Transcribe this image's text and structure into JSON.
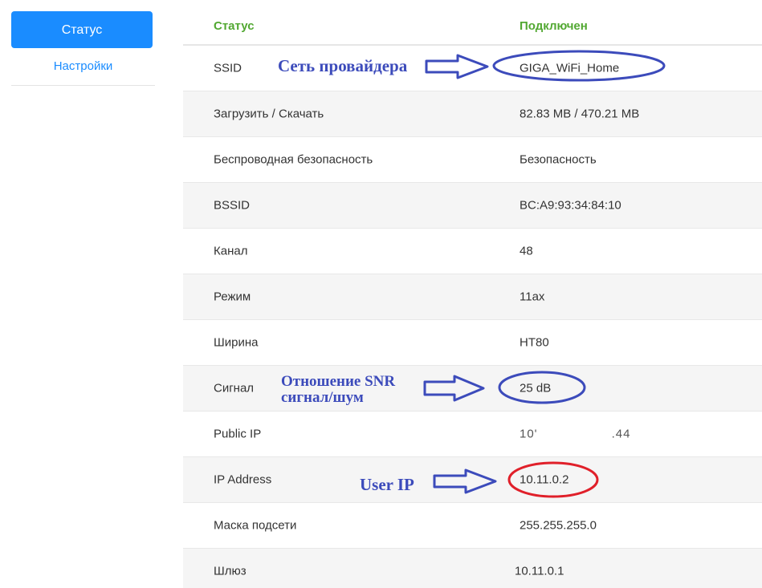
{
  "sidebar": {
    "status_button": "Статус",
    "settings_link": "Настройки"
  },
  "table": {
    "header_label": "Статус",
    "header_value": "Подключен",
    "rows": [
      {
        "label": "SSID",
        "value": "GIGA_WiFi_Home"
      },
      {
        "label": "Загрузить / Скачать",
        "value": "82.83 MB / 470.21 MB"
      },
      {
        "label": "Беспроводная безопасность",
        "value": "Безопасность"
      },
      {
        "label": "BSSID",
        "value": "BC:A9:93:34:84:10"
      },
      {
        "label": "Канал",
        "value": "48"
      },
      {
        "label": "Режим",
        "value": "11ax"
      },
      {
        "label": "Ширина",
        "value": "HT80"
      },
      {
        "label": "Сигнал",
        "value": "25 dB"
      },
      {
        "label": "Public IP",
        "value_start": "10'",
        "value_end": ".44"
      },
      {
        "label": "IP Address",
        "value": "10.11.0.2"
      },
      {
        "label": "Маска подсети",
        "value": "255.255.255.0"
      },
      {
        "label": "Шлюз",
        "value": "10.11.0.1"
      }
    ]
  },
  "annotations": {
    "ssid_note": "Сеть провайдера",
    "snr_note_line1": "Отношение SNR",
    "snr_note_line2": "сигнал/шум",
    "ip_note": "User IP",
    "colors": {
      "blue": "#3c4bbb",
      "red": "#e0202a"
    }
  },
  "colors": {
    "accent": "#1a8cff",
    "header_green": "#52a832"
  }
}
